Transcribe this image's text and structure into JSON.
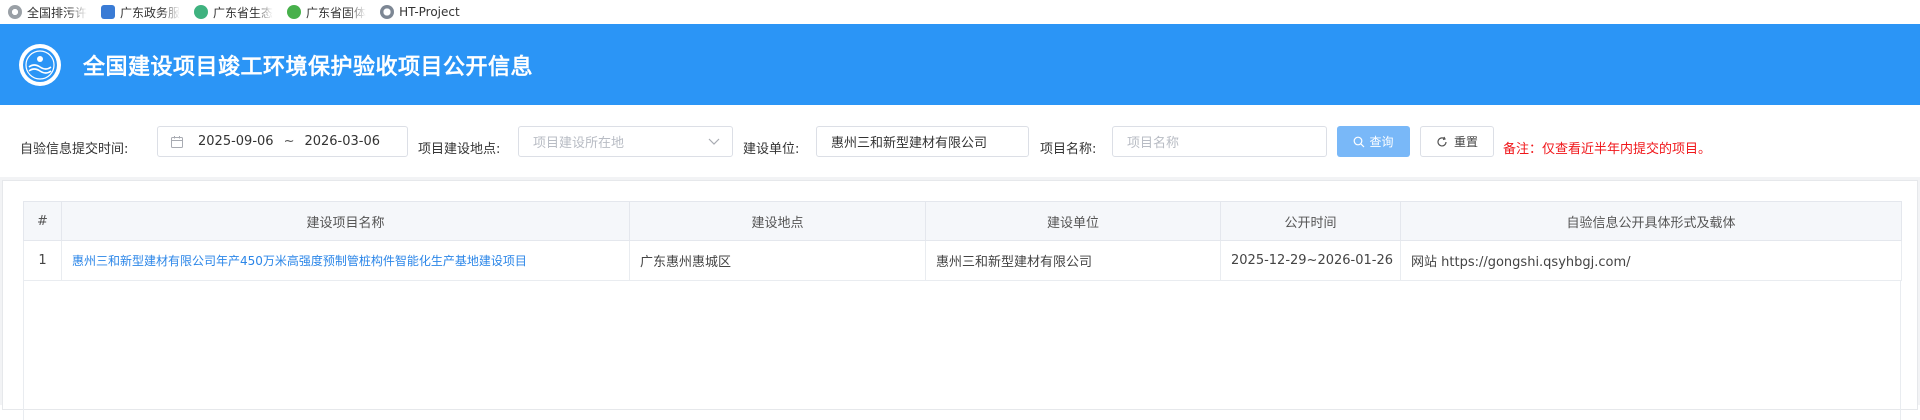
{
  "bookmarks": [
    {
      "label": "全国排污许",
      "icon": "gear-icon",
      "color": "#9aa0a6"
    },
    {
      "label": "广东政务服",
      "icon": "puzzle-icon",
      "color": "#3a7bd5"
    },
    {
      "label": "广东省生态",
      "icon": "leaf-icon",
      "color": "#3fb27f"
    },
    {
      "label": "广东省固体",
      "icon": "recycle-icon",
      "color": "#47b04b"
    },
    {
      "label": "HT-Project",
      "icon": "globe-icon",
      "color": "#7d8794"
    }
  ],
  "header": {
    "title": "全国建设项目竣工环境保护验收项目公开信息",
    "bg_color": "#2b95f6"
  },
  "filters": {
    "date_label": "自验信息提交时间:",
    "date_start": "2025-09-06",
    "date_sep": "~",
    "date_end": "2026-03-06",
    "location_label": "项目建设地点:",
    "location_placeholder": "项目建设所在地",
    "unit_label": "建设单位:",
    "unit_value": "惠州三和新型建材有限公司",
    "name_label": "项目名称:",
    "name_placeholder": "项目名称",
    "query_label": "查询",
    "reset_label": "重置",
    "note": "备注：仅查看近半年内提交的项目。"
  },
  "table": {
    "headers": [
      "#",
      "建设项目名称",
      "建设地点",
      "建设单位",
      "公开时间",
      "自验信息公开具体形式及载体"
    ],
    "rows": [
      {
        "index": "1",
        "name": "惠州三和新型建材有限公司年产450万米高强度预制管桩构件智能化生产基地建设项目",
        "location": "广东惠州惠城区",
        "unit": "惠州三和新型建材有限公司",
        "period": "2025-12-29~2026-01-26",
        "carrier": "网站 https://gongshi.qsyhbgj.com/"
      }
    ]
  }
}
